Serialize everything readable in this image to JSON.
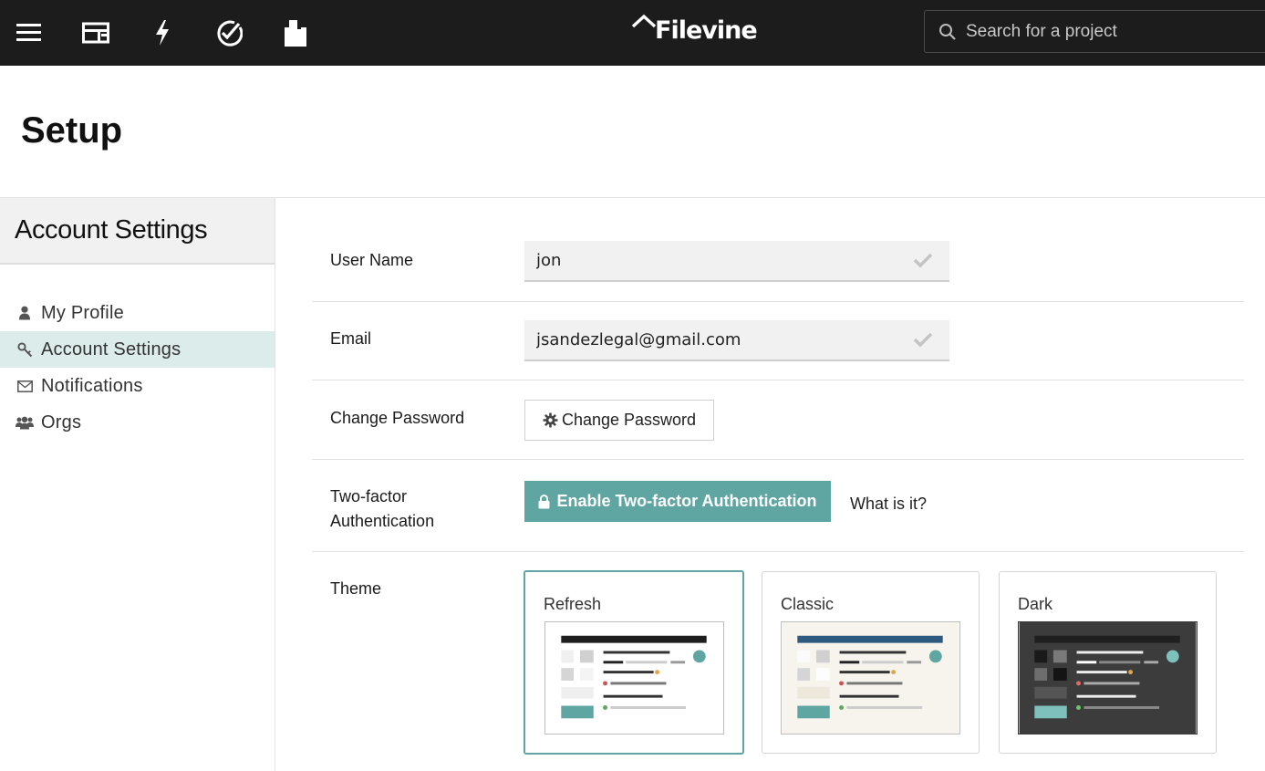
{
  "app": {
    "logo_text": "Filevine",
    "search_placeholder": "Search for a project",
    "nav_icons": [
      "menu-icon",
      "dashboard-icon",
      "activity-icon",
      "tasks-icon",
      "documents-icon"
    ]
  },
  "page": {
    "title": "Setup"
  },
  "sidebar": {
    "heading": "Account Settings",
    "items": [
      {
        "label": "My Profile",
        "icon": "user-icon",
        "active": false
      },
      {
        "label": "Account Settings",
        "icon": "key-icon",
        "active": true
      },
      {
        "label": "Notifications",
        "icon": "envelope-icon",
        "active": false
      },
      {
        "label": "Orgs",
        "icon": "users-icon",
        "active": false
      }
    ]
  },
  "form": {
    "username_label": "User Name",
    "username_value": "jon",
    "email_label": "Email",
    "email_value": "jsandezlegal@gmail.com",
    "password_label": "Change Password",
    "password_button": "Change Password",
    "twofactor_label_line1": "Two-factor",
    "twofactor_label_line2": "Authentication",
    "twofactor_button": "Enable Two-factor Authentication",
    "twofactor_link": "What is it?",
    "theme_label": "Theme",
    "themes": [
      {
        "name": "Refresh",
        "selected": true
      },
      {
        "name": "Classic",
        "selected": false
      },
      {
        "name": "Dark",
        "selected": false
      }
    ]
  },
  "colors": {
    "topbar": "#1c1c1c",
    "accent": "#5fa5a1",
    "active_nav_bg": "#dceceb",
    "classic_bar": "#2f5a7f",
    "dark_bg": "#3c3c3c"
  }
}
